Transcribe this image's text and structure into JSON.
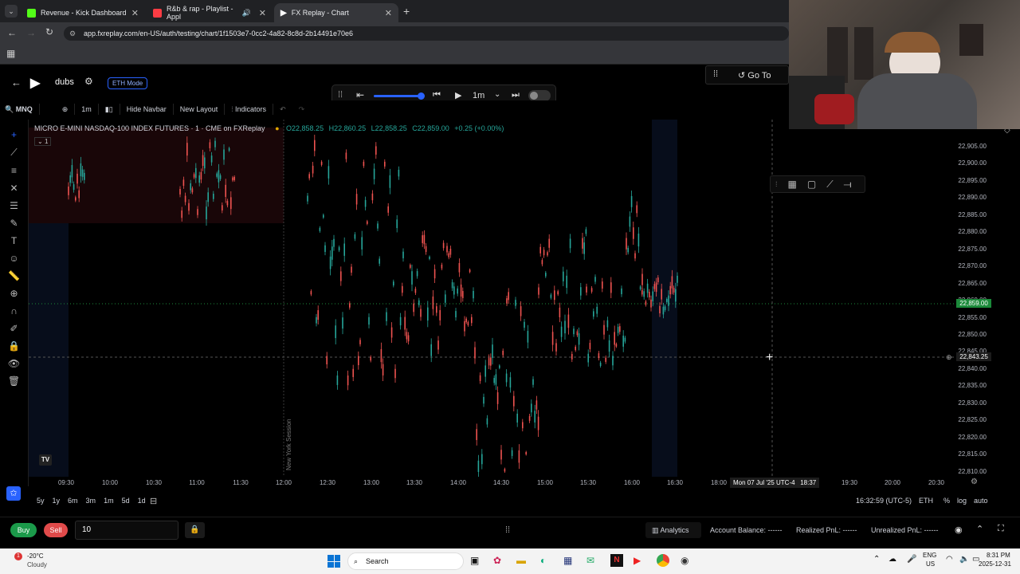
{
  "tabs": [
    {
      "label": "Revenue - Kick Dashboard",
      "color": "#53fc18"
    },
    {
      "label": "R&b & rap - Playlist - Appl",
      "color": "#fc3c44"
    },
    {
      "label": "FX Replay - Chart",
      "color": "#ffffff"
    }
  ],
  "url": "app.fxreplay.com/en-US/auth/testing/chart/1f1503e7-0cc2-4a82-8c8d-2b14491e70e6",
  "header": {
    "name": "dubs",
    "eth_mode": "ETH Mode",
    "goto": "Go To"
  },
  "toolbar": {
    "symbol": "MNQ",
    "interval": "1m",
    "hide_navbar": "Hide Navbar",
    "new_layout": "New Layout",
    "indicators": "Indicators"
  },
  "player": {
    "interval": "1m"
  },
  "legend": {
    "title": "MICRO E-MINI NASDAQ-100 INDEX FUTURES · 1 · CME on FXReplay",
    "o": "O22,858.25",
    "h": "H22,860.25",
    "l": "L22,858.25",
    "c": "C22,859.00",
    "chg": "+0.25 (+0.00%)",
    "count": "1"
  },
  "session_label": "New York Session",
  "price_labels": [
    "22,905.00",
    "22,900.00",
    "22,895.00",
    "22,890.00",
    "22,885.00",
    "22,880.00",
    "22,875.00",
    "22,870.00",
    "22,865.00",
    "22,860.00",
    "22,855.00",
    "22,850.00",
    "22,845.00",
    "22,840.00",
    "22,835.00",
    "22,830.00",
    "22,825.00",
    "22,820.00",
    "22,815.00",
    "22,810.00"
  ],
  "current_price": "22,859.00",
  "crosshair_price": "22,843.25",
  "time_labels": [
    "09:30",
    "10:00",
    "10:30",
    "11:00",
    "11:30",
    "12:00",
    "12:30",
    "13:00",
    "13:30",
    "14:00",
    "14:30",
    "15:00",
    "15:30",
    "16:00",
    "16:30",
    "18:00",
    "19:30",
    "20:00",
    "20:30"
  ],
  "crosshair_time": "Mon 07 Jul '25 UTC-4   18:37",
  "ranges": [
    "5y",
    "1y",
    "6m",
    "3m",
    "1m",
    "5d",
    "1d"
  ],
  "clock": "16:32:59 (UTC-5)",
  "axis_opts": {
    "eth": "ETH",
    "pct": "%",
    "log": "log",
    "auto": "auto"
  },
  "order": {
    "buy": "Buy",
    "sell": "Sell",
    "qty": "10"
  },
  "account": {
    "analytics": "Analytics",
    "balance": "Account Balance: ------",
    "realized": "Realized PnL: ------",
    "unrealized": "Unrealized PnL: ------"
  },
  "weather": {
    "temp": "-20°C",
    "cond": "Cloudy",
    "badge": "1"
  },
  "search_label": "Search",
  "locale": {
    "lang": "ENG",
    "region": "US"
  },
  "time": "8:31 PM",
  "date": "2025-12-31",
  "colors": {
    "up": "#26a69a",
    "down": "#ef5350",
    "accent": "#2962ff",
    "price_tag": "#1b8a3a"
  }
}
